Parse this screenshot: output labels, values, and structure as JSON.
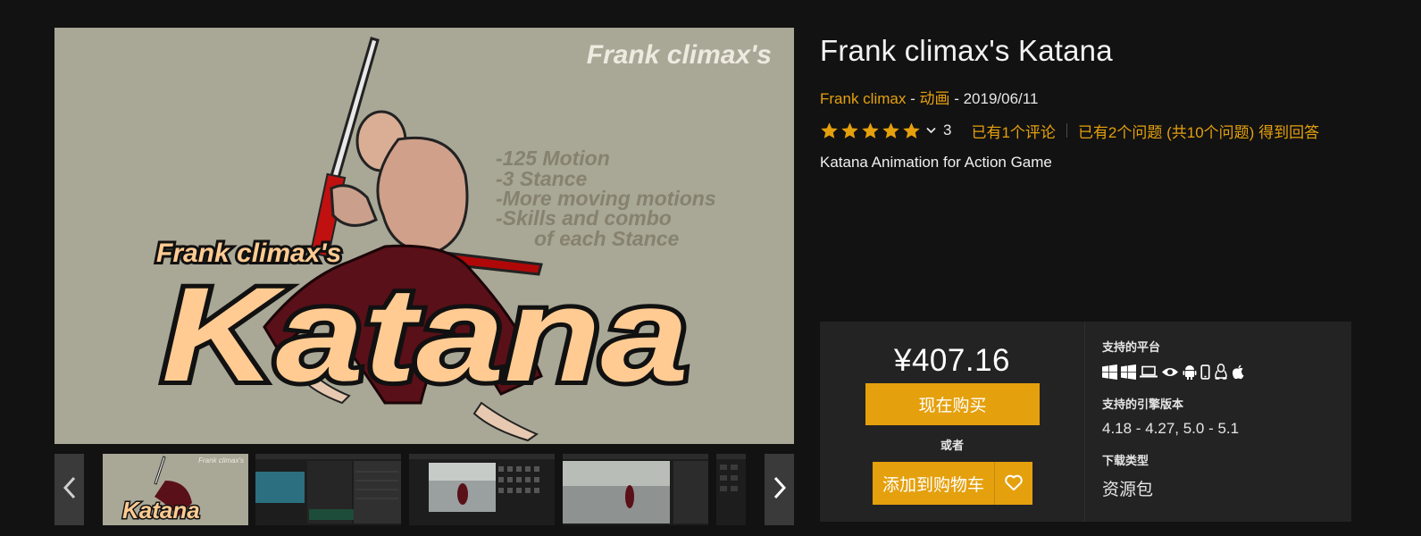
{
  "gallery": {
    "hero": {
      "top_caption": "Frank climax's",
      "overlay_caption": "Frank climax's",
      "logo_word": "Katana",
      "feature_lines": [
        "-125 Motion",
        "-3 Stance",
        "-More moving motions",
        "-Skills and combo",
        "of each Stance"
      ]
    },
    "thumbnails": [
      {
        "kind": "cover",
        "caption": "Frank climax's",
        "logo": "Katana"
      },
      {
        "kind": "editor"
      },
      {
        "kind": "editor"
      },
      {
        "kind": "editor"
      },
      {
        "kind": "editor"
      }
    ],
    "prev_icon": "chevron-left-icon",
    "next_icon": "chevron-right-icon"
  },
  "product": {
    "title": "Frank climax's Katana",
    "seller": "Frank climax",
    "meta_separator": " - ",
    "category": "动画",
    "date": "2019/06/11",
    "rating_stars": 5,
    "rating_count": "3",
    "reviews_link": "已有1个评论",
    "questions_link": "已有2个问题 (共10个问题) 得到回答",
    "description": "Katana Animation for Action Game"
  },
  "purchase": {
    "price": "¥407.16",
    "buy_label": "现在购买",
    "or_label": "或者",
    "cart_label": "添加到购物车",
    "wishlist_icon": "heart-icon"
  },
  "specs": {
    "platforms_label": "支持的平台",
    "platform_icons": [
      "windows-icon",
      "windows-icon",
      "laptop-icon",
      "eye-icon",
      "android-icon",
      "phone-icon",
      "linux-icon",
      "apple-icon"
    ],
    "engine_label": "支持的引擎版本",
    "engine_value": "4.18 - 4.27, 5.0 - 5.1",
    "download_label": "下载类型",
    "download_value": "资源包"
  },
  "colors": {
    "accent": "#e5a00d",
    "background": "#121212",
    "panel": "#232323",
    "hero_bg": "#a9a796"
  }
}
